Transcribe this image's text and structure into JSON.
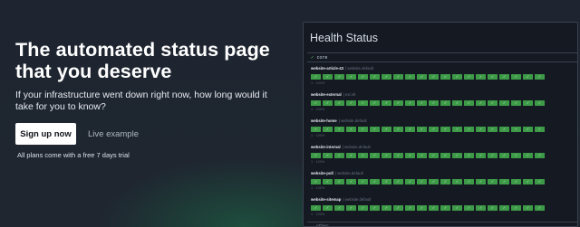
{
  "hero": {
    "title": "The automated status page that you deserve",
    "subtitle": "If your infrastructure went down right now, how long would it take for you to know?",
    "signup_label": "Sign up now",
    "live_example_label": "Live example",
    "plans_note": "All plans come with a free 7 days trial"
  },
  "panel": {
    "title": "Health Status",
    "group": {
      "check_icon": "check-icon",
      "name": "core"
    },
    "endpoints": [
      {
        "name": "website-article-43",
        "group": "| website.default",
        "meta_left": "1 · 100%",
        "meta_right": ""
      },
      {
        "name": "website-external",
        "group": "| ext.vlt",
        "meta_left": "1 · 100%",
        "meta_right": ""
      },
      {
        "name": "website-home",
        "group": "| website.default",
        "meta_left": "1 · 100%",
        "meta_right": ""
      },
      {
        "name": "website-internal",
        "group": "| website.default",
        "meta_left": "1 · 100%",
        "meta_right": ""
      },
      {
        "name": "website-poll",
        "group": "| website.default",
        "meta_left": "1 · 100%",
        "meta_right": ""
      },
      {
        "name": "website-sitemap",
        "group": "| website.default",
        "meta_left": "1 · 100%",
        "meta_right": ""
      }
    ],
    "checks_per_row": 20,
    "check_status": "success",
    "next_group": "other"
  },
  "colors": {
    "success": "#3d9a47",
    "panel_bg": "#141922",
    "page_bg": "#1f2630"
  }
}
